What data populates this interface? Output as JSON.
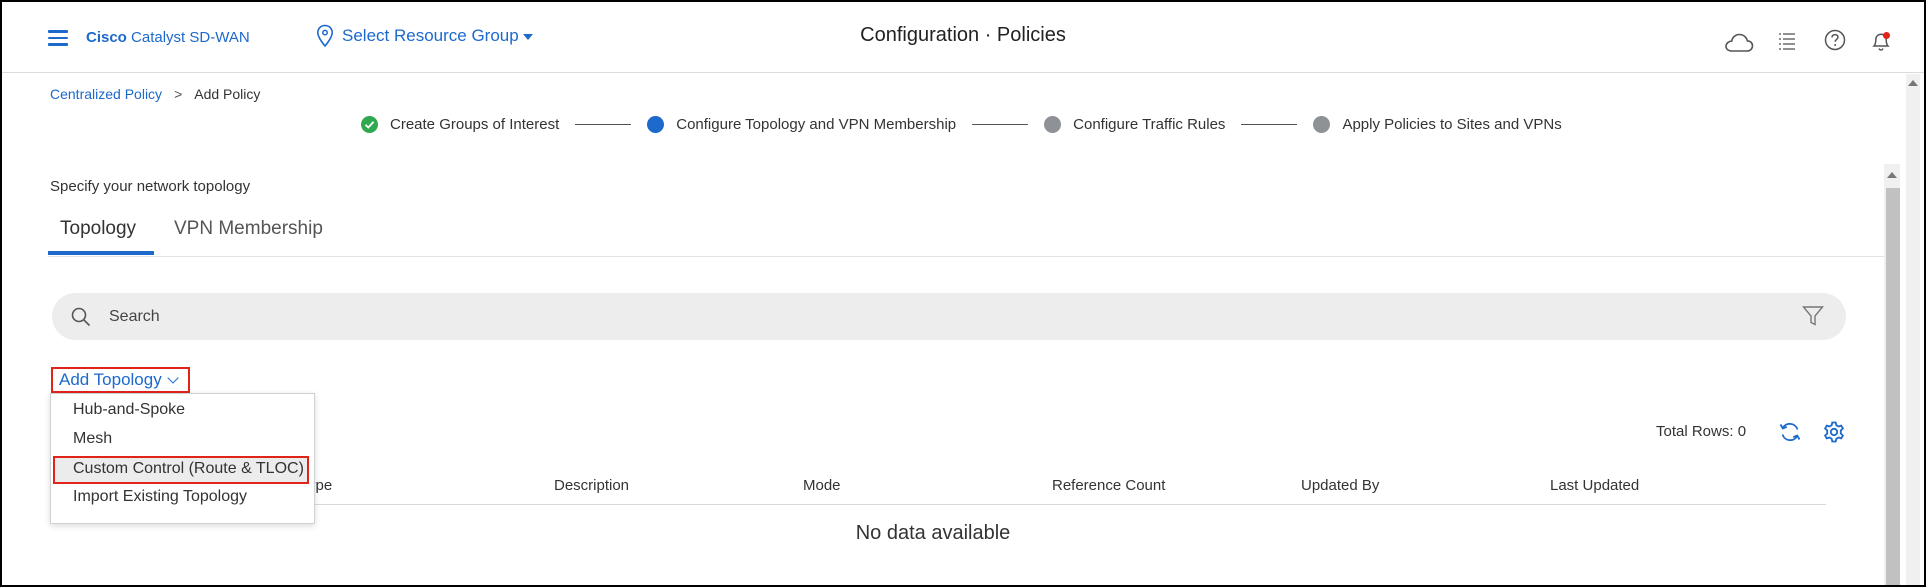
{
  "header": {
    "brand_bold": "Cisco",
    "brand_rest": " Catalyst SD-WAN",
    "resource_group": "Select Resource Group",
    "title": "Configuration · Policies"
  },
  "breadcrumb": {
    "parent": "Centralized Policy",
    "separator": ">",
    "current": "Add Policy"
  },
  "stepper": {
    "steps": [
      {
        "label": "Create Groups of Interest",
        "state": "done"
      },
      {
        "label": "Configure Topology and VPN Membership",
        "state": "active"
      },
      {
        "label": "Configure Traffic Rules",
        "state": "pending"
      },
      {
        "label": "Apply Policies to Sites and VPNs",
        "state": "pending"
      }
    ]
  },
  "content": {
    "subtitle": "Specify your network topology",
    "tabs": [
      {
        "label": "Topology",
        "active": true
      },
      {
        "label": "VPN Membership",
        "active": false
      }
    ],
    "search_placeholder": "Search",
    "add_button": "Add Topology",
    "total_rows": "Total Rows: 0",
    "columns": [
      "Type",
      "Description",
      "Mode",
      "Reference Count",
      "Updated By",
      "Last Updated"
    ],
    "visible_type_fragment": "ype",
    "empty_message": "No data available"
  },
  "dropdown": {
    "items": [
      {
        "label": "Hub-and-Spoke",
        "highlighted": false
      },
      {
        "label": "Mesh",
        "highlighted": false
      },
      {
        "label": "Custom Control (Route & TLOC)",
        "highlighted": true
      },
      {
        "label": "Import Existing Topology",
        "highlighted": false
      }
    ]
  },
  "icons": {
    "menu": "hamburger-icon",
    "location": "location-pin-icon",
    "cloud": "cloud-icon",
    "tasks": "list-icon",
    "help": "help-icon",
    "notifications": "bell-icon",
    "search": "search-icon",
    "filter": "filter-icon",
    "refresh": "refresh-icon",
    "settings": "gear-icon",
    "step_done": "check-icon"
  },
  "colors": {
    "accent": "#1d69cc",
    "success": "#2fa84f",
    "pending": "#8e9196",
    "highlight_border": "#e2231a"
  }
}
